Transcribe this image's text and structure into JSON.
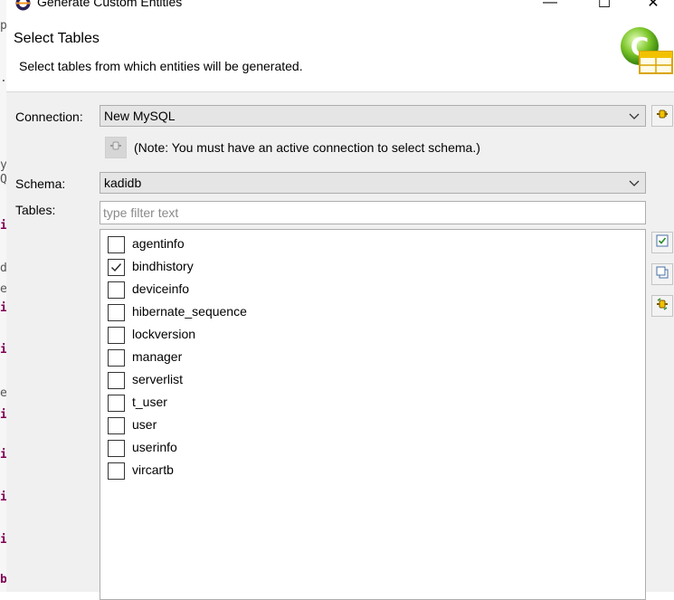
{
  "window": {
    "title": "Generate Custom Entities",
    "minimize_label": "—",
    "maximize_label": "☐",
    "close_label": "✕"
  },
  "header": {
    "title": "Select Tables",
    "description": "Select tables from which entities will be generated."
  },
  "connection": {
    "label": "Connection:",
    "value": "New MySQL",
    "note": "(Note: You must have an active connection to select schema.)"
  },
  "schema": {
    "label": "Schema:",
    "value": "kadidb"
  },
  "tables": {
    "label": "Tables:",
    "filter_placeholder": "type filter text",
    "items": [
      {
        "name": "agentinfo",
        "checked": false
      },
      {
        "name": "bindhistory",
        "checked": true
      },
      {
        "name": "deviceinfo",
        "checked": false
      },
      {
        "name": "hibernate_sequence",
        "checked": false
      },
      {
        "name": "lockversion",
        "checked": false
      },
      {
        "name": "manager",
        "checked": false
      },
      {
        "name": "serverlist",
        "checked": false
      },
      {
        "name": "t_user",
        "checked": false
      },
      {
        "name": "user",
        "checked": false
      },
      {
        "name": "userinfo",
        "checked": false
      },
      {
        "name": "vircartb",
        "checked": false
      }
    ]
  },
  "background_editor": {
    "fragments": [
      "p",
      ".",
      "y",
      "Q",
      "i",
      "d",
      "e",
      "i",
      "i",
      "e",
      "i",
      "i",
      "i",
      "i",
      "b"
    ]
  },
  "colors": {
    "accent_keyword": "#7f0055",
    "dialog_bg": "#f0f0f0",
    "combo_bg": "#e5e5e5"
  }
}
